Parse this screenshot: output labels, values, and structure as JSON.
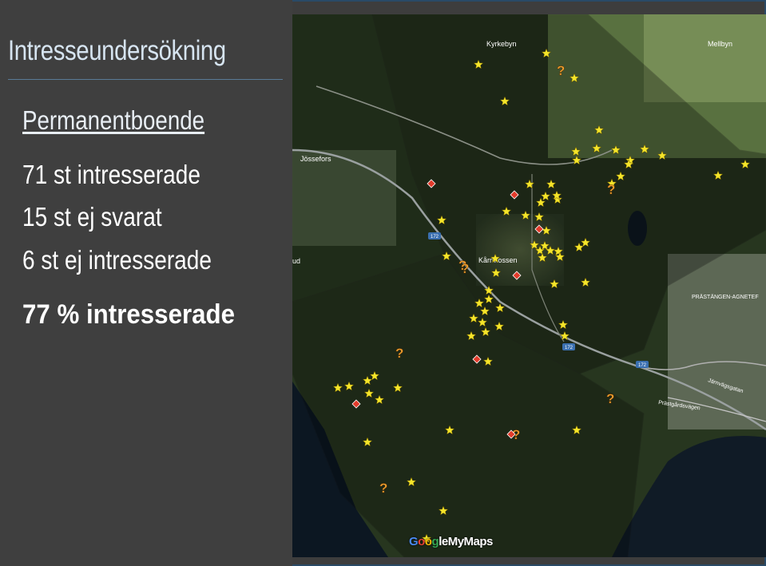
{
  "panel": {
    "title": "Intresseundersökning",
    "subtitle": "Permanentboende",
    "stats": [
      "71 st intresserade",
      "15 st ej svarat",
      "6 st ej intresserade"
    ],
    "summary": "77 %  intresserade"
  },
  "map": {
    "place_labels": [
      "Kyrkebyn",
      "Mellbyn",
      "Jössefors",
      "Kårrmossen",
      "ud",
      "PRÄSTÄNGEN-AGNETEF",
      "Järnvägsgatan",
      "Prästgårdsvägen"
    ],
    "road_signs": [
      "172",
      "172",
      "172"
    ],
    "attribution": {
      "g1": "G",
      "g2": "o",
      "g3": "o",
      "g4": "g",
      "rest": "leMyMaps"
    },
    "marker_types": {
      "interested": "star-icon",
      "no_answer": "question-icon",
      "not_interested": "diamond-icon"
    },
    "colors": {
      "star": "#f5e52a",
      "question": "#f0a030",
      "diamond": "#e23b2b",
      "zone": "#000000"
    }
  }
}
